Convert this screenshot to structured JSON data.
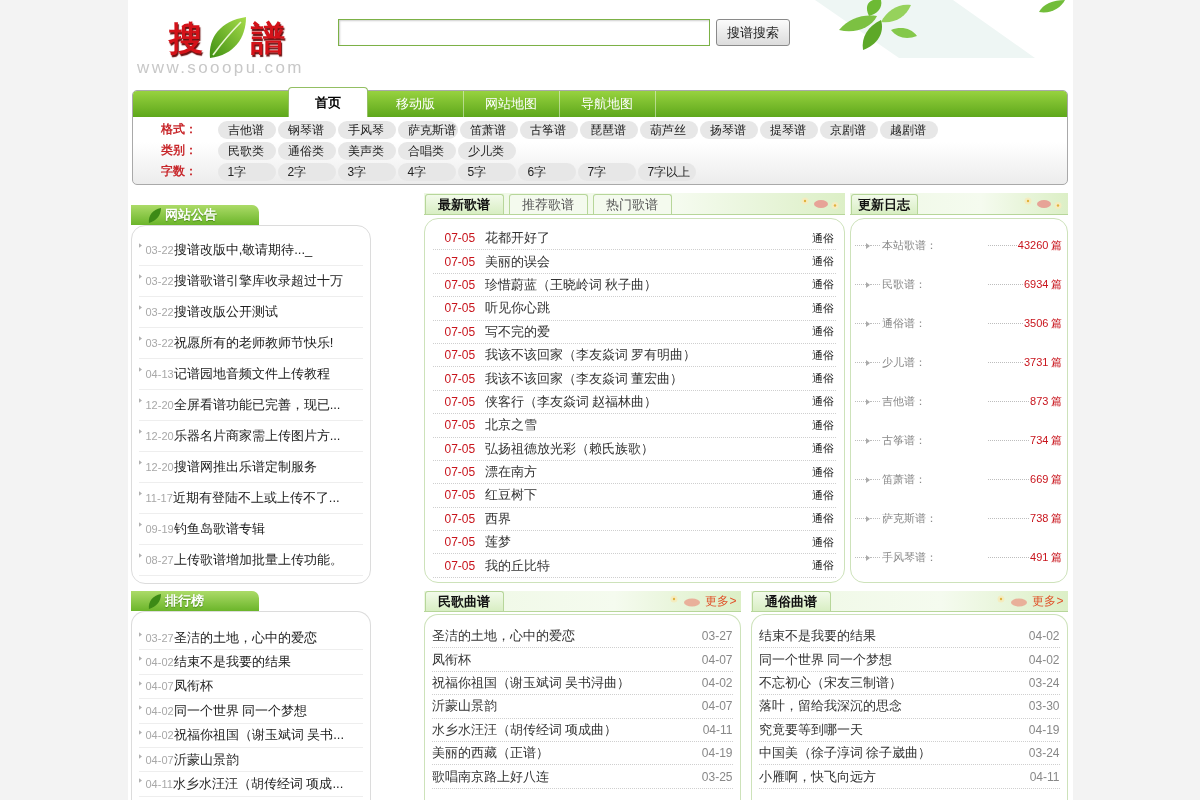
{
  "header": {
    "logo": {
      "chars": [
        "搜",
        "譜"
      ],
      "url": "www.sooopu.com"
    },
    "search_button": "搜谱搜索"
  },
  "nav": {
    "tabs": [
      {
        "label": "首页",
        "selected": true
      },
      {
        "label": "移动版",
        "selected": false
      },
      {
        "label": "网站地图",
        "selected": false
      },
      {
        "label": "导航地图",
        "selected": false
      }
    ],
    "filters": [
      {
        "label": "格式：",
        "items": [
          "吉他谱",
          "钢琴谱",
          "手风琴",
          "萨克斯谱",
          "笛萧谱",
          "古筝谱",
          "琵琶谱",
          "葫芦丝",
          "扬琴谱",
          "提琴谱",
          "京剧谱",
          "越剧谱"
        ]
      },
      {
        "label": "类别：",
        "items": [
          "民歌类",
          "通俗类",
          "美声类",
          "合唱类",
          "少儿类"
        ]
      },
      {
        "label": "字数：",
        "items": [
          "1字",
          "2字",
          "3字",
          "4字",
          "5字",
          "6字",
          "7字",
          "7字以上"
        ]
      }
    ]
  },
  "sidebar": [
    {
      "title": "网站公告",
      "items": [
        {
          "date": "03-22",
          "text": "搜谱改版中,敬请期待..._"
        },
        {
          "date": "03-22",
          "text": "搜谱歌谱引擎库收录超过十万"
        },
        {
          "date": "03-22",
          "text": "搜谱改版公开测试"
        },
        {
          "date": "03-22",
          "text": "祝愿所有的老师教师节快乐!"
        },
        {
          "date": "04-13",
          "text": "记谱园地音频文件上传教程"
        },
        {
          "date": "12-20",
          "text": "全屏看谱功能已完善，现已..."
        },
        {
          "date": "12-20",
          "text": "乐器名片商家需上传图片方..."
        },
        {
          "date": "12-20",
          "text": "搜谱网推出乐谱定制服务"
        },
        {
          "date": "11-17",
          "text": "近期有登陆不上或上传不了..."
        },
        {
          "date": "09-19",
          "text": "钓鱼岛歌谱专辑"
        },
        {
          "date": "08-27",
          "text": "上传歌谱增加批量上传功能。"
        }
      ]
    },
    {
      "title": "排行榜",
      "items": [
        {
          "date": "03-27",
          "text": "圣洁的土地，心中的爱恋"
        },
        {
          "date": "04-02",
          "text": "结束不是我要的结果"
        },
        {
          "date": "04-07",
          "text": "凤衔杯"
        },
        {
          "date": "04-02",
          "text": "同一个世界 同一个梦想"
        },
        {
          "date": "04-02",
          "text": "祝福你祖国（谢玉斌词 吴书..."
        },
        {
          "date": "04-07",
          "text": "沂蒙山景韵"
        },
        {
          "date": "04-11",
          "text": "水乡水汪汪（胡传经词 项成..."
        }
      ]
    }
  ],
  "latest": {
    "tabs": [
      {
        "label": "最新歌谱",
        "selected": true
      },
      {
        "label": "推荐歌谱",
        "selected": false
      },
      {
        "label": "热门歌谱",
        "selected": false
      }
    ],
    "rows": [
      {
        "date": "07-05",
        "title": "花都开好了",
        "category": "通俗"
      },
      {
        "date": "07-05",
        "title": "美丽的误会",
        "category": "通俗"
      },
      {
        "date": "07-05",
        "title": "珍惜蔚蓝（王晓岭词 秋子曲）",
        "category": "通俗"
      },
      {
        "date": "07-05",
        "title": "听见你心跳",
        "category": "通俗"
      },
      {
        "date": "07-05",
        "title": "写不完的爱",
        "category": "通俗"
      },
      {
        "date": "07-05",
        "title": "我该不该回家（李友焱词 罗有明曲）",
        "category": "通俗"
      },
      {
        "date": "07-05",
        "title": "我该不该回家（李友焱词 董宏曲）",
        "category": "通俗"
      },
      {
        "date": "07-05",
        "title": "侠客行（李友焱词 赵福林曲）",
        "category": "通俗"
      },
      {
        "date": "07-05",
        "title": "北京之雪",
        "category": "通俗"
      },
      {
        "date": "07-05",
        "title": "弘扬祖德放光彩（赖氏族歌）",
        "category": "通俗"
      },
      {
        "date": "07-05",
        "title": "漂在南方",
        "category": "通俗"
      },
      {
        "date": "07-05",
        "title": "红豆树下",
        "category": "通俗"
      },
      {
        "date": "07-05",
        "title": "西界",
        "category": "通俗"
      },
      {
        "date": "07-05",
        "title": "莲梦",
        "category": "通俗"
      },
      {
        "date": "07-05",
        "title": "我的丘比特",
        "category": "通俗"
      }
    ]
  },
  "update_log": {
    "title": "更新日志",
    "rows": [
      {
        "label": "本站歌谱：",
        "count": "43260 篇"
      },
      {
        "label": "民歌谱：",
        "count": "6934 篇"
      },
      {
        "label": "通俗谱：",
        "count": "3506 篇"
      },
      {
        "label": "少儿谱：",
        "count": "3731 篇"
      },
      {
        "label": "吉他谱：",
        "count": "873 篇"
      },
      {
        "label": "古筝谱：",
        "count": "734 篇"
      },
      {
        "label": "笛萧谱：",
        "count": "669 篇"
      },
      {
        "label": "萨克斯谱：",
        "count": "738 篇"
      },
      {
        "label": "手风琴谱：",
        "count": "491 篇"
      }
    ]
  },
  "bottom_lists": [
    {
      "title": "民歌曲谱",
      "more": "更多>",
      "rows": [
        {
          "title": "圣洁的土地，心中的爱恋",
          "date": "03-27"
        },
        {
          "title": "凤衔杯",
          "date": "04-07"
        },
        {
          "title": "祝福你祖国（谢玉斌词 吴书浔曲）",
          "date": "04-02"
        },
        {
          "title": "沂蒙山景韵",
          "date": "04-07"
        },
        {
          "title": "水乡水汪汪（胡传经词 项成曲）",
          "date": "04-11"
        },
        {
          "title": "美丽的西藏（正谱）",
          "date": "04-19"
        },
        {
          "title": "歌唱南京路上好八连",
          "date": "03-25"
        }
      ]
    },
    {
      "title": "通俗曲谱",
      "more": "更多>",
      "rows": [
        {
          "title": "结束不是我要的结果",
          "date": "04-02"
        },
        {
          "title": "同一个世界 同一个梦想",
          "date": "04-02"
        },
        {
          "title": "不忘初心（宋友三制谱）",
          "date": "03-24"
        },
        {
          "title": "落叶，留给我深沉的思念",
          "date": "03-30"
        },
        {
          "title": "究竟要等到哪一天",
          "date": "04-19"
        },
        {
          "title": "中国美（徐子淳词 徐子崴曲）",
          "date": "03-24"
        },
        {
          "title": "小雁啊，快飞向远方",
          "date": "04-11"
        }
      ]
    }
  ]
}
